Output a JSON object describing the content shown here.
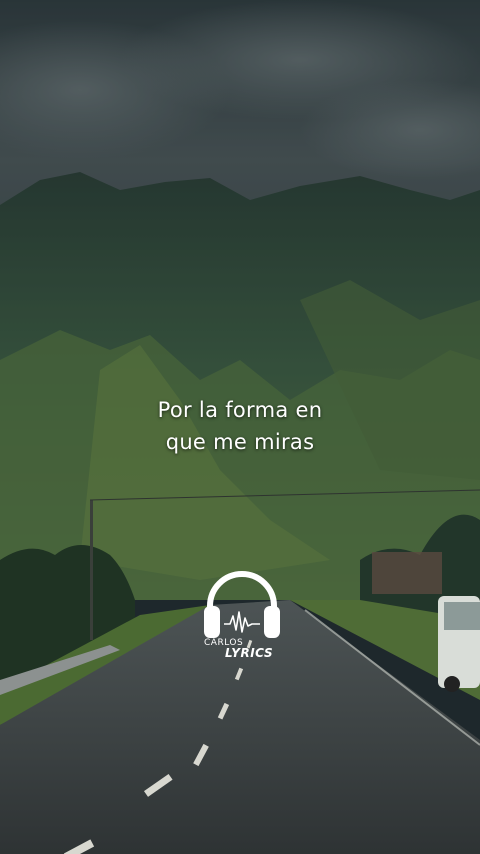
{
  "lyrics": {
    "line1": "Por la forma en",
    "line2": "que me miras"
  },
  "watermark": {
    "top": "CARLOS",
    "bottom": "LYRICS",
    "icon": "headphones-icon"
  },
  "colors": {
    "sky": "#3f4b4e",
    "mountain": "#3e6245",
    "grass": "#6b8a45",
    "road": "#3f4546",
    "text": "#ffffff"
  }
}
